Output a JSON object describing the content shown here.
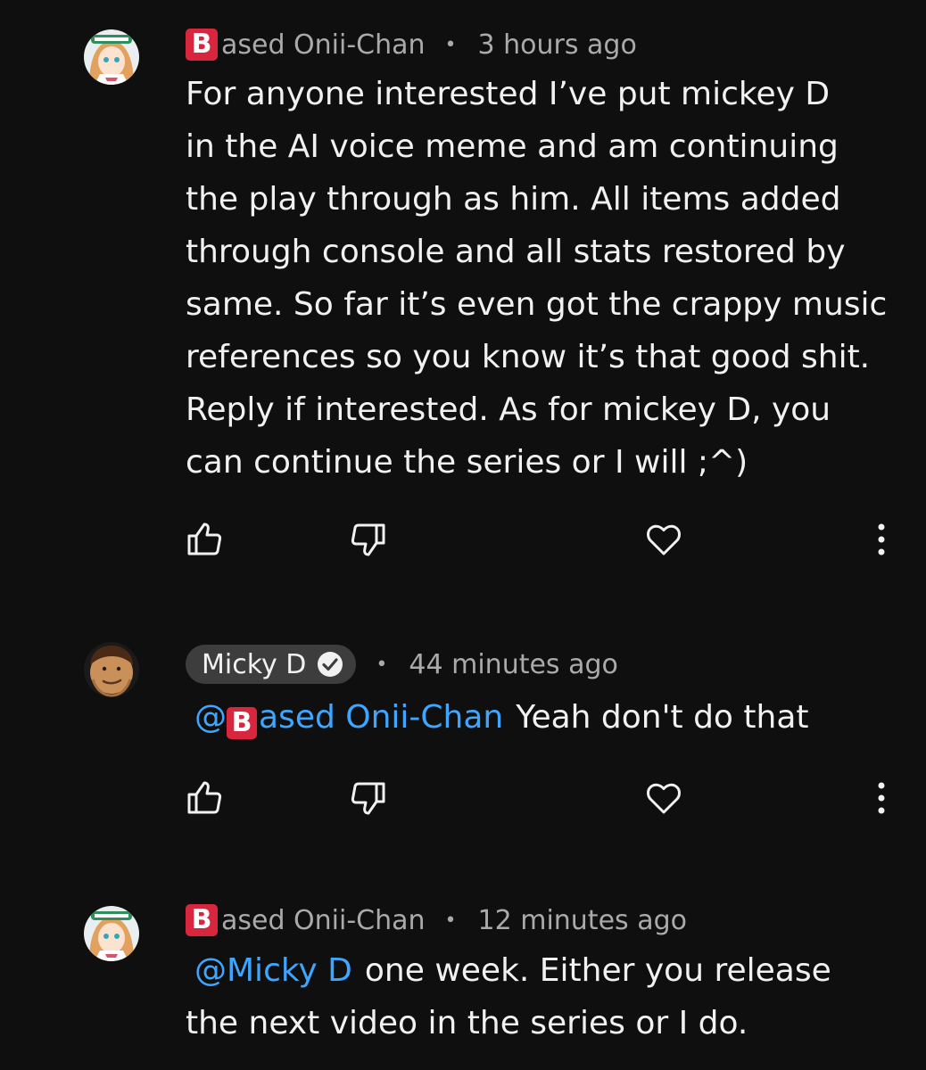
{
  "comments": [
    {
      "author": "ased Onii-Chan",
      "author_badge": "B",
      "separator": "•",
      "time": "3 hours ago",
      "is_creator": false,
      "avatar": "anime-girl-avatar",
      "body_lines": [
        "For anyone interested I’ve put mickey D",
        "in the AI voice meme and am continuing",
        "the play through as him. All items added",
        "through console and all stats restored by",
        "same. So far it’s even got the crappy music",
        "references so you know it’s that good shit.",
        "Reply if interested. As for mickey D, you",
        "can continue the series or I will ;^)"
      ],
      "actions": [
        "thumbs-up-icon",
        "thumbs-down-icon",
        "heart-icon",
        "more-vert-icon"
      ]
    },
    {
      "author": "Micky D",
      "separator": "•",
      "time": "44 minutes ago",
      "is_creator": true,
      "avatar": "cartoon-face-avatar",
      "mention_prefix": "@",
      "mention_badge": "B",
      "mention_name": "ased Onii-Chan",
      "body_lines": [
        "Yeah don't do that"
      ],
      "actions": [
        "thumbs-up-icon",
        "thumbs-down-icon",
        "heart-icon",
        "more-vert-icon"
      ]
    },
    {
      "author": "ased Onii-Chan",
      "author_badge": "B",
      "separator": "•",
      "time": "12 minutes ago",
      "is_creator": false,
      "avatar": "anime-girl-avatar",
      "mention": "@Micky D",
      "body_lines": [
        "one week. Either you release",
        "the next video in the series or I do."
      ],
      "actions": [
        "thumbs-up-icon",
        "thumbs-down-icon",
        "heart-icon",
        "more-vert-icon"
      ]
    }
  ],
  "colors": {
    "background": "#0f0f0f",
    "text": "#f1f1f1",
    "meta": "#aaaaaa",
    "mention": "#3ea6ff",
    "badge": "#d7263d",
    "creator_pill": "#3d3d3d"
  }
}
